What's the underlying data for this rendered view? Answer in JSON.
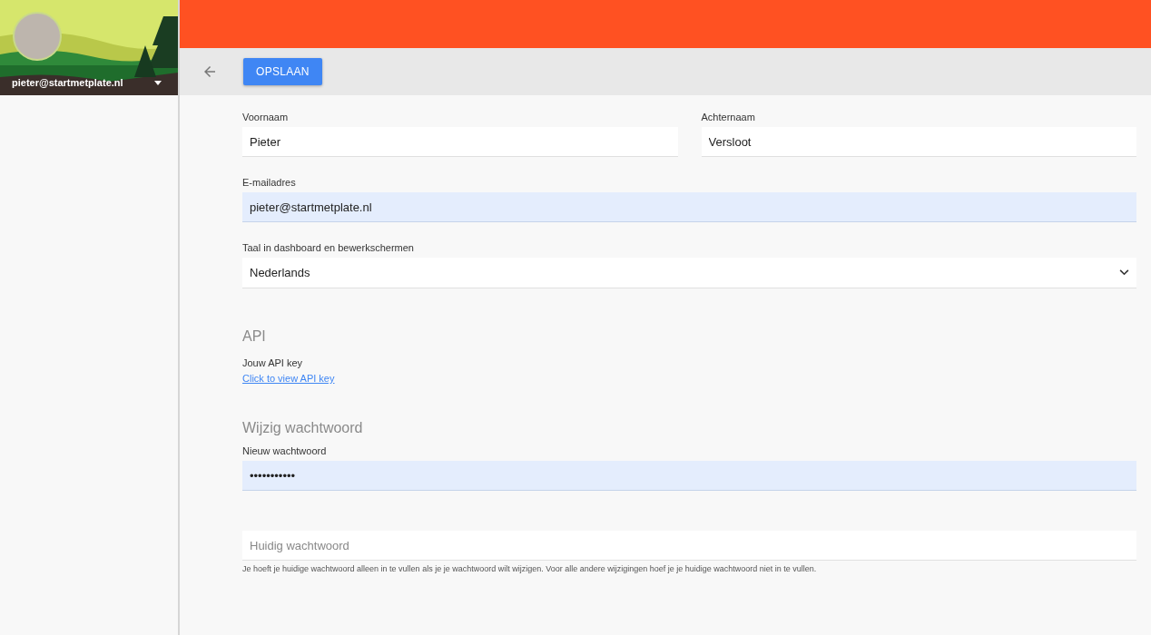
{
  "sidebar": {
    "account_email": "pieter@startmetplate.nl"
  },
  "toolbar": {
    "save_button": "OPSLAAN"
  },
  "name_fields": [
    {
      "label": "Voornaam",
      "value": "Pieter",
      "autofilled": false
    },
    {
      "label": "Achternaam",
      "value": "Versloot",
      "autofilled": false
    }
  ],
  "email_field": {
    "label": "E-mailadres",
    "value": "pieter@startmetplate.nl",
    "autofilled": true
  },
  "language_select": {
    "label": "Taal in dashboard en bewerkschermen",
    "value": "Nederlands"
  },
  "api_section": {
    "heading": "API",
    "label": "Jouw API key",
    "link": "Click to view API key"
  },
  "password_section": {
    "heading": "Wijzig wachtwoord",
    "new_password": {
      "label": "Nieuw wachtwoord",
      "value": "•••••••••••",
      "autofilled": true
    },
    "current_password": {
      "placeholder": "Huidig wachtwoord",
      "autofilled": false
    },
    "hint": "Je hoeft je huidige wachtwoord alleen in te vullen als je je wachtwoord wilt wijzigen. Voor alle andere wijzigingen hoef je je huidige wachtwoord niet in te vullen."
  }
}
